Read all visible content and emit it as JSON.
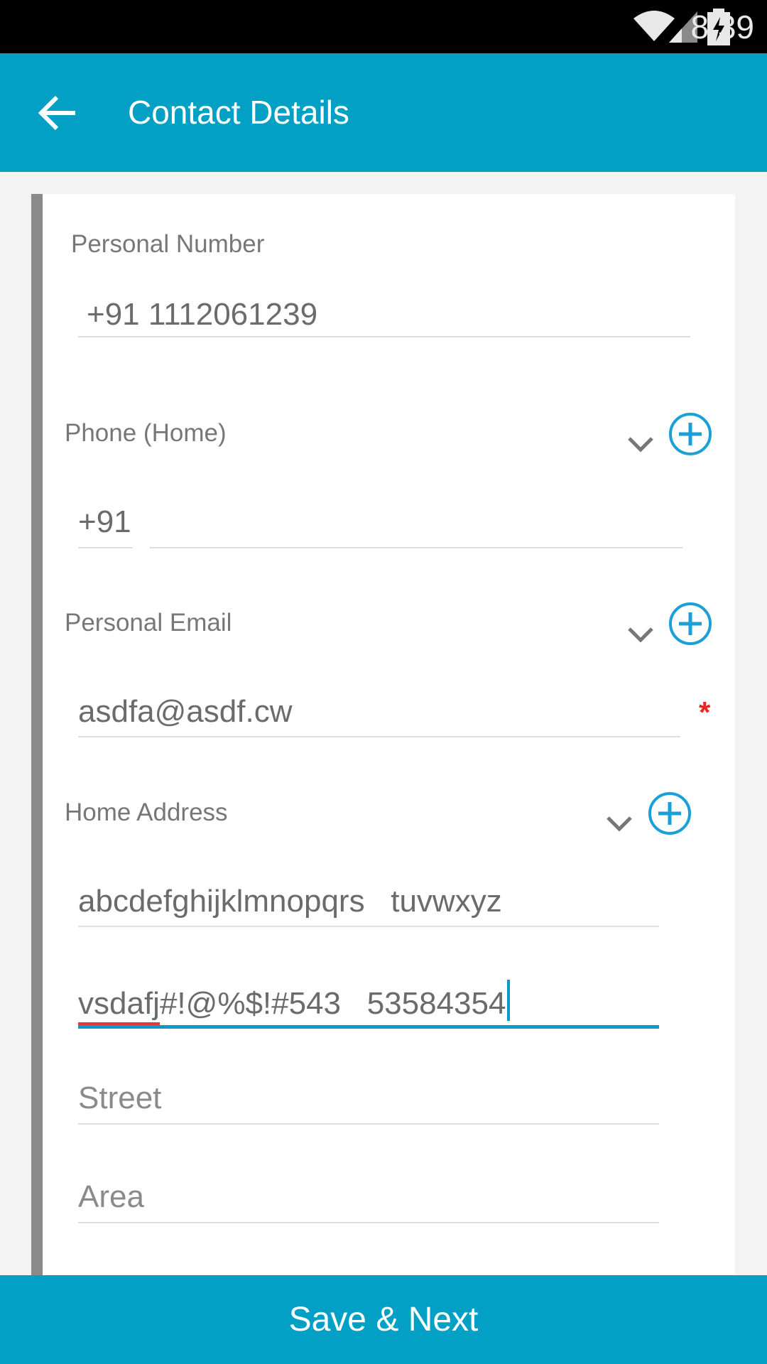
{
  "status": {
    "time": "8:39",
    "icons": [
      "wifi-icon",
      "signal-icon",
      "battery-charging-icon"
    ]
  },
  "header": {
    "title": "Contact Details",
    "back_icon": "arrow-left-icon"
  },
  "form": {
    "personal_number": {
      "label": "Personal Number",
      "value": "+91 1112061239"
    },
    "phone_home": {
      "label": "Phone (Home)",
      "code": "+91",
      "value": ""
    },
    "personal_email": {
      "label": "Personal Email",
      "value": "asdfa@asdf.cw",
      "required_mark": "*"
    },
    "home_address": {
      "label": "Home Address",
      "line1": "abcdefghijklmnopqrs   tuvwxyz",
      "line2_misspelled": "vsdafj",
      "line2_rest": "#!@%$!#543   53584354",
      "street_placeholder": "Street",
      "area_placeholder": "Area"
    }
  },
  "footer": {
    "save_label": "Save & Next"
  },
  "colors": {
    "accent": "#03a0c6",
    "required": "#e22222",
    "spellcheck": "#e53935"
  }
}
